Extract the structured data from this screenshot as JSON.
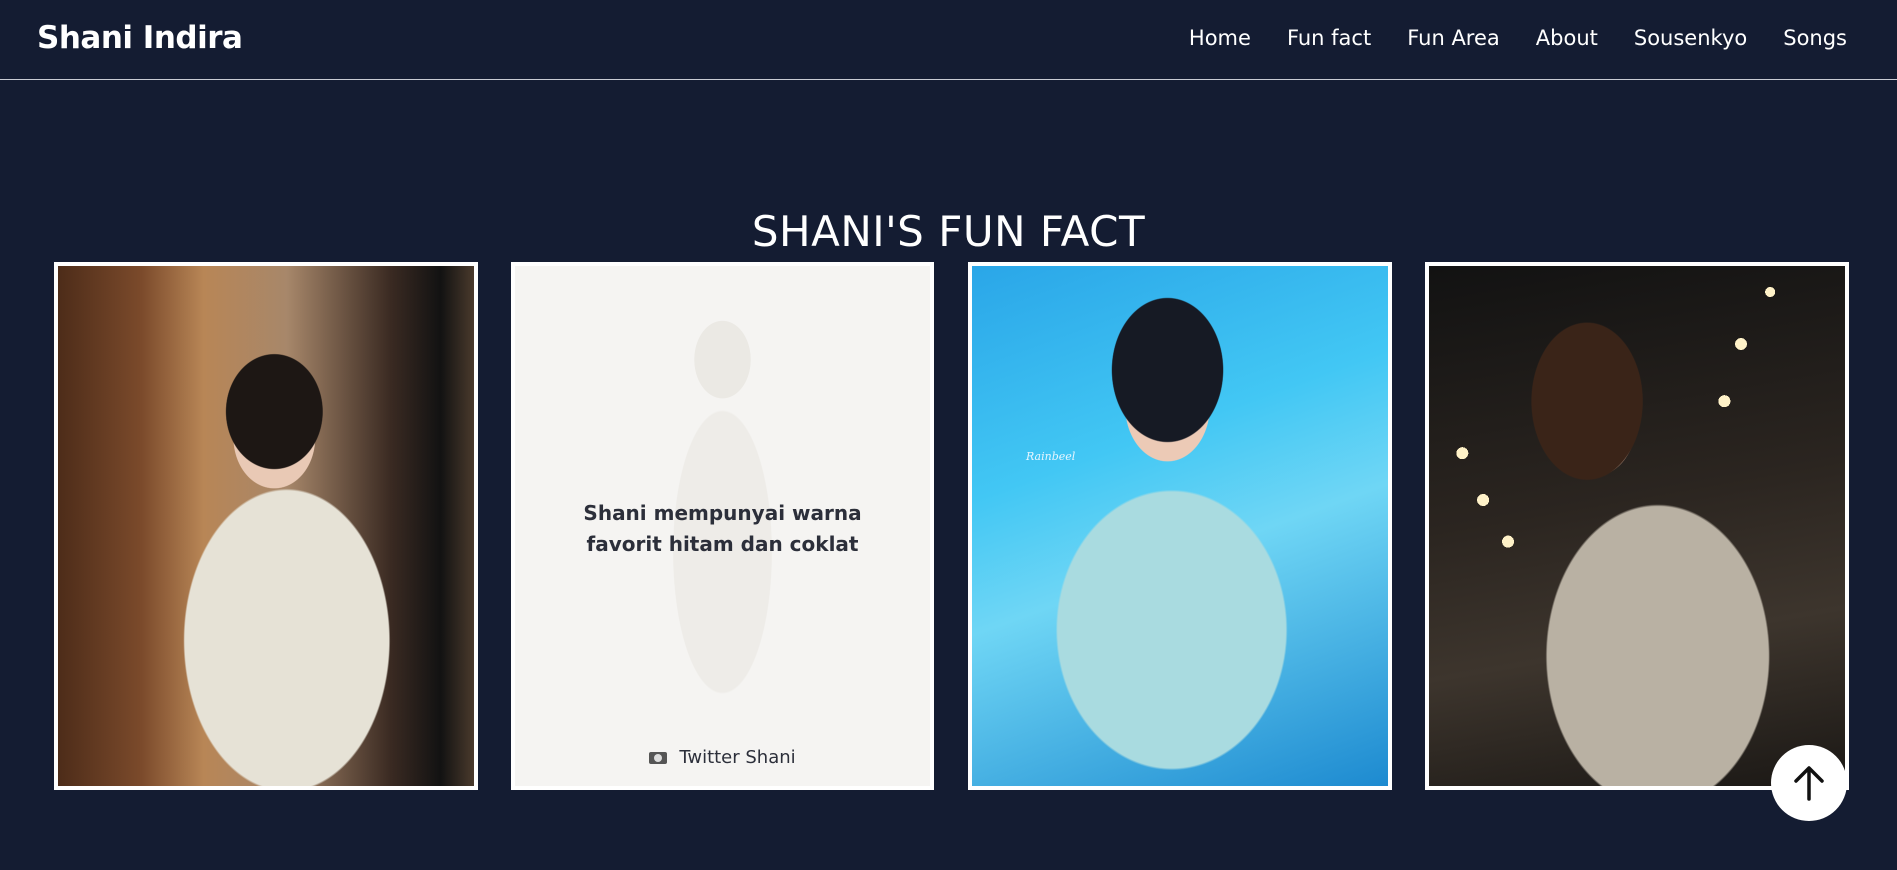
{
  "header": {
    "brand": "Shani Indira",
    "nav": [
      "Home",
      "Fun fact",
      "Fun Area",
      "About",
      "Sousenkyo",
      "Songs"
    ]
  },
  "section": {
    "title": "SHANI'S FUN FACT"
  },
  "cards": {
    "fact_text": "Shani mempunyai warna favorit hitam dan coklat",
    "credit": "Twitter Shani",
    "watermark": "Rainbeel"
  },
  "icons": {
    "scroll_top": "arrow-up-icon",
    "credit": "camera-icon"
  },
  "colors": {
    "background": "#141c32",
    "text": "#ffffff",
    "card_border": "#ffffff"
  }
}
